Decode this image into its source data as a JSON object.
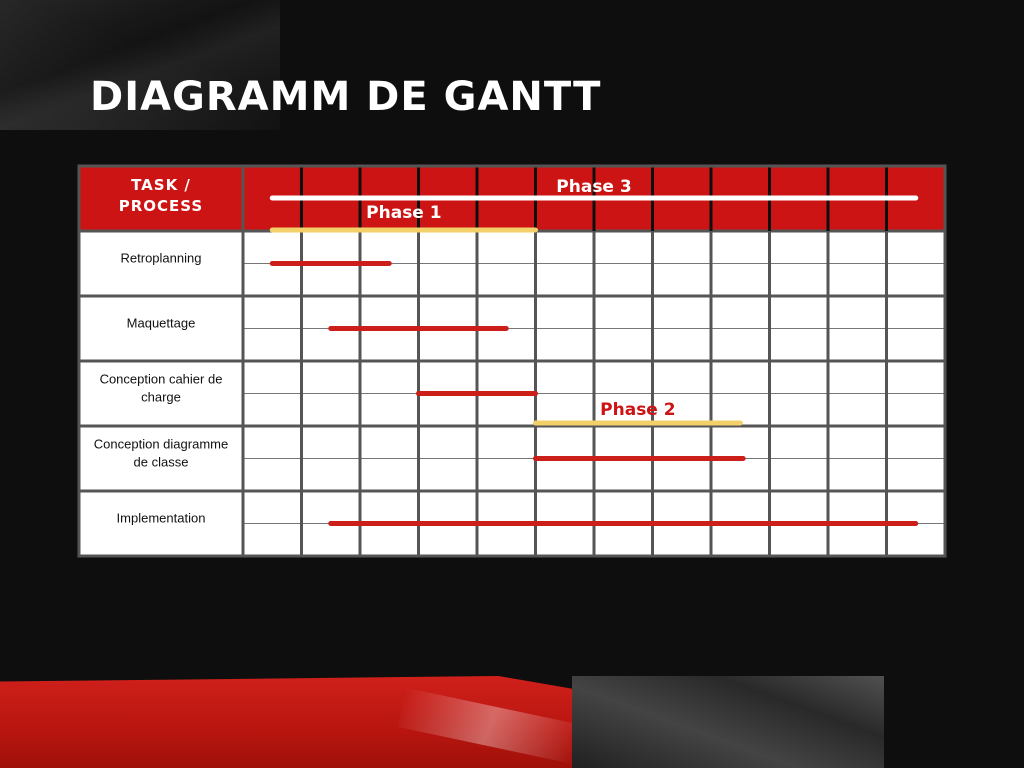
{
  "page_title": "DIAGRAMM DE GANTT",
  "colors": {
    "header_red": "#cc1414",
    "task_bar_red": "#cc1f1a",
    "phase_yellow": "#f3d06a",
    "phase3_white": "#ffffff",
    "grid_line": "#555555",
    "cell_bg": "#ffffff",
    "page_bg": "#0e0e0e"
  },
  "chart_data": {
    "type": "gantt",
    "header_label_lines": [
      "TASK /",
      "PROCESS"
    ],
    "time_columns": 12,
    "tasks": [
      {
        "label_lines": [
          "Retroplanning"
        ],
        "start": 0.5,
        "end": 2.5
      },
      {
        "label_lines": [
          "Maquettage"
        ],
        "start": 1.5,
        "end": 4.5
      },
      {
        "label_lines": [
          "Conception cahier de",
          "charge"
        ],
        "start": 3.0,
        "end": 5.0
      },
      {
        "label_lines": [
          "Conception diagramme",
          "de classe"
        ],
        "start": 5.0,
        "end": 8.55
      },
      {
        "label_lines": [
          "Implementation"
        ],
        "start": 1.5,
        "end": 11.5
      }
    ],
    "phases": [
      {
        "name": "Phase 3",
        "start": 0.5,
        "end": 11.5,
        "color": "#ffffff",
        "label_color": "#ffffff"
      },
      {
        "name": "Phase 1",
        "start": 0.5,
        "end": 5.0,
        "color": "#f3d06a",
        "label_color": "#ffffff"
      },
      {
        "name": "Phase 2",
        "start": 5.0,
        "end": 8.5,
        "color": "#f3d06a",
        "label_color": "#cc1414"
      }
    ]
  }
}
